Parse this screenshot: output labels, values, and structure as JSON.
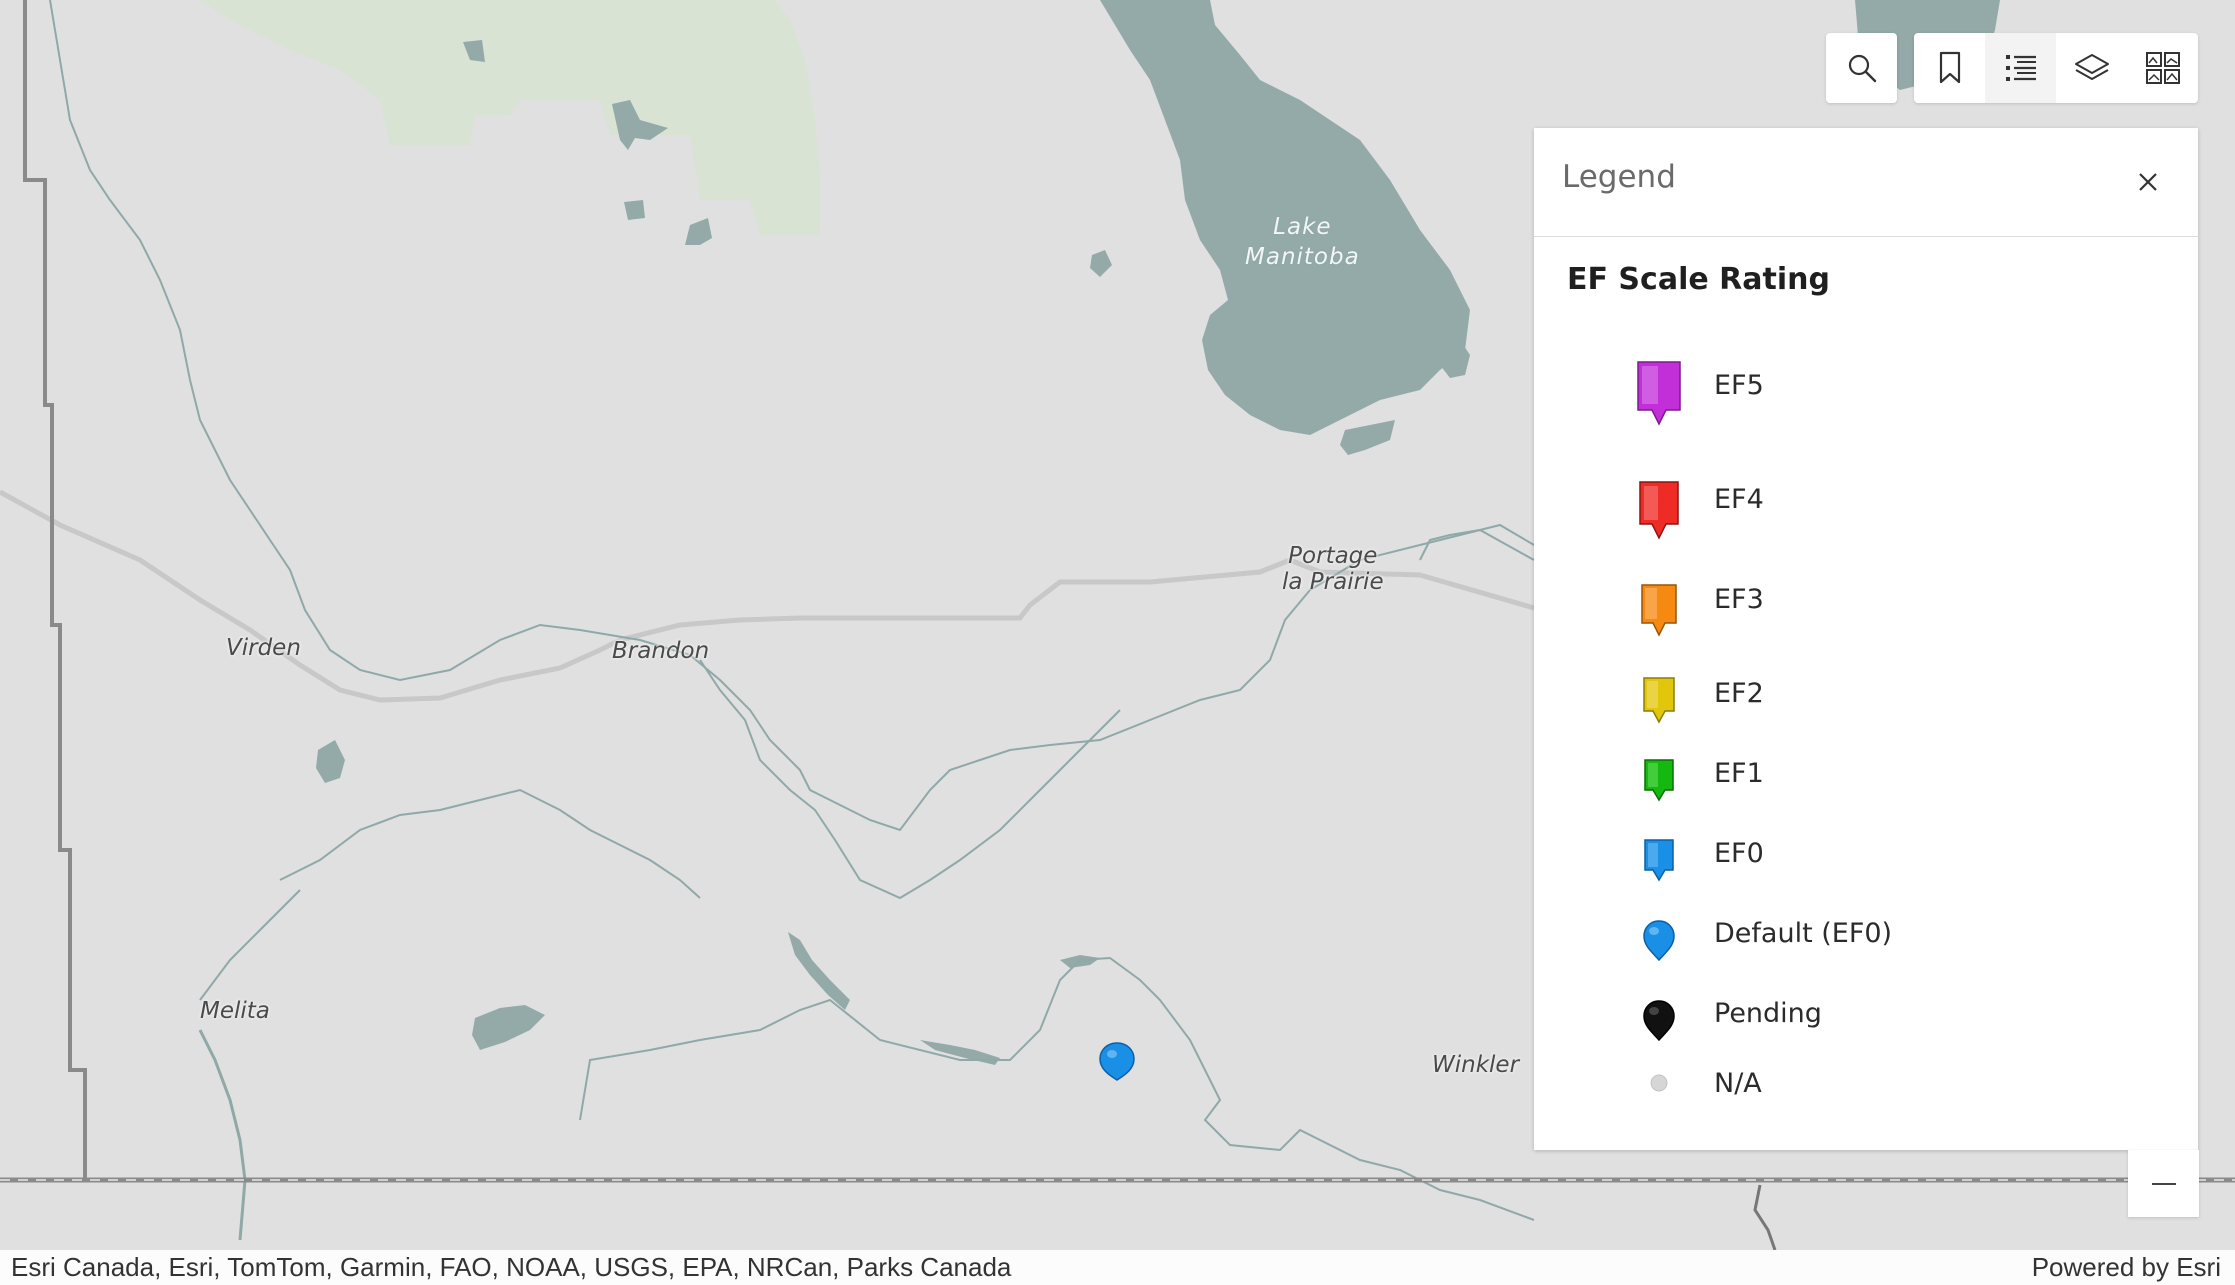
{
  "map": {
    "place_labels": [
      "Virden",
      "Brandon",
      "Melita",
      "Winkler",
      "Portage",
      "la Prairie"
    ],
    "water_labels": [
      "Lake",
      "Manitoba"
    ],
    "colors": {
      "land": "#e0e0e0",
      "water": "#93aaa9",
      "park": "#d8e3d4",
      "river": "#8fa8a8",
      "road": "#c8c8c8",
      "boundary": "#8a8a8a"
    }
  },
  "toolbar": {
    "search_icon": "search-icon",
    "bookmarks_icon": "bookmark-icon",
    "legend_icon": "legend-list-icon",
    "layers_icon": "layers-icon",
    "basemap_icon": "basemap-gallery-icon"
  },
  "legend": {
    "title": "Legend",
    "close_icon": "close-icon",
    "layer_title": "EF Scale Rating",
    "items": [
      {
        "label": "EF5",
        "color": "#c22fd8",
        "symbol": "square-pin"
      },
      {
        "label": "EF4",
        "color": "#ef2b25",
        "symbol": "square-pin"
      },
      {
        "label": "EF3",
        "color": "#f6890f",
        "symbol": "square-pin"
      },
      {
        "label": "EF2",
        "color": "#e0c70b",
        "symbol": "square-pin"
      },
      {
        "label": "EF1",
        "color": "#15b80f",
        "symbol": "square-pin"
      },
      {
        "label": "EF0",
        "color": "#1a8fe6",
        "symbol": "square-pin"
      },
      {
        "label": "Default (EF0)",
        "color": "#1a8fe6",
        "symbol": "round-pin"
      },
      {
        "label": "Pending",
        "color": "#111111",
        "symbol": "round-pin"
      },
      {
        "label": "N/A",
        "color": "#d6d6d6",
        "symbol": "dot"
      }
    ]
  },
  "zoom": {
    "out_icon": "minus-icon"
  },
  "attribution": {
    "credits": "Esri Canada, Esri, TomTom, Garmin, FAO, NOAA, USGS, EPA, NRCan, Parks Canada",
    "powered_by": "Powered by Esri"
  }
}
